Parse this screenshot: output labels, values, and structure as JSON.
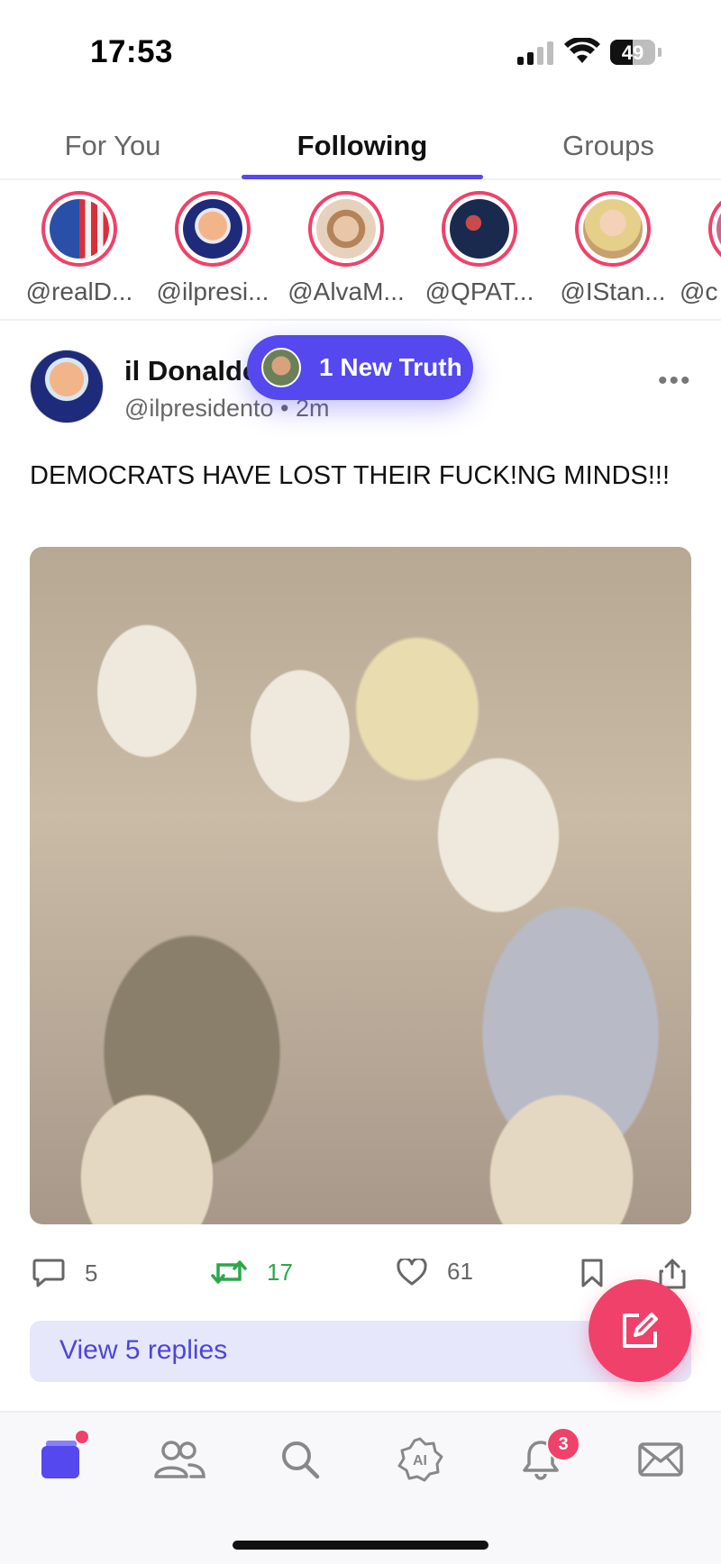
{
  "status_bar": {
    "time": "17:53",
    "battery": "49",
    "battery_level": 0.49
  },
  "tabs": [
    {
      "label": "For You"
    },
    {
      "label": "Following"
    },
    {
      "label": "Groups"
    }
  ],
  "stories": [
    {
      "handle": "@realD..."
    },
    {
      "handle": "@ilpresi..."
    },
    {
      "handle": "@AlvaM..."
    },
    {
      "handle": "@QPAT..."
    },
    {
      "handle": "@IStan..."
    },
    {
      "handle": "@c"
    }
  ],
  "new_truth": {
    "label": "1 New Truth"
  },
  "post": {
    "author_name": "il Donaldo",
    "author_handle": "@ilpresidento",
    "time_ago": "2m",
    "text": "DEMOCRATS HAVE LOST THEIR FUCK!NG MINDS!!!",
    "replies_count": "5",
    "retruths_count": "17",
    "likes_count": "61",
    "view_replies_label": "View 5 replies"
  },
  "nav": {
    "notifications_badge": "3"
  },
  "colors": {
    "accent": "#5448ee",
    "pink": "#f0416a",
    "retruth_green": "#2aa84a"
  },
  "icons": [
    "signal-icon",
    "wifi-icon",
    "battery-icon",
    "comment-icon",
    "retruth-icon",
    "heart-icon",
    "bookmark-icon",
    "share-icon",
    "compose-icon",
    "feed-icon",
    "groups-icon",
    "search-icon",
    "ai-icon",
    "bell-icon",
    "mail-icon"
  ]
}
